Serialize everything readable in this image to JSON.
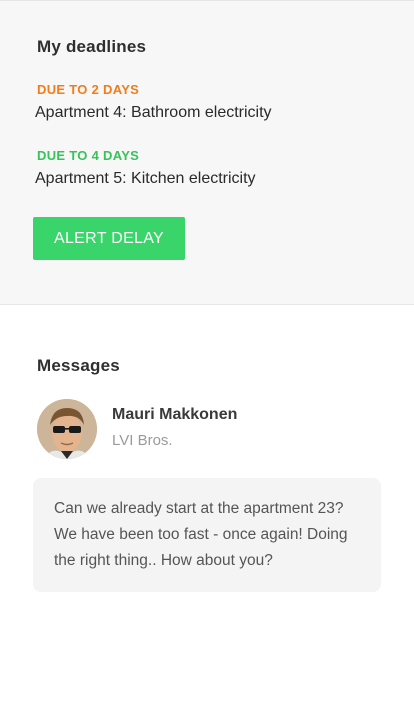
{
  "deadlines": {
    "title": "My deadlines",
    "items": [
      {
        "due": "DUE TO 2 DAYS",
        "task": "Apartment 4: Bathroom electricity",
        "due_color": "#f07d1a"
      },
      {
        "due": "DUE TO 4 DAYS",
        "task": "Apartment 5: Kitchen electricity",
        "due_color": "#35c35a"
      }
    ],
    "alert_button_label": "ALERT DELAY"
  },
  "messages": {
    "title": "Messages",
    "items": [
      {
        "sender": "Mauri Makkonen",
        "company": "LVI Bros.",
        "text": "Can we already start at the apartment 23? We have been too fast - once again! Doing the right thing.. How about you?"
      }
    ]
  },
  "colors": {
    "accent_green": "#39d46a",
    "warning_orange": "#f07d1a"
  }
}
